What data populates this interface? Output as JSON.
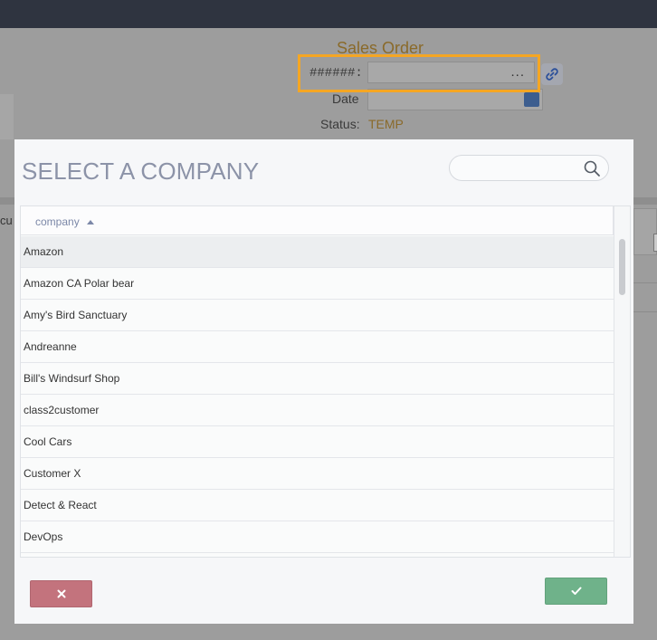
{
  "background": {
    "form_title": "Sales Order",
    "number_label": "######:",
    "number_dots": "...",
    "date_label": "Date",
    "status_label": "Status:",
    "status_value": "TEMP",
    "cut_text": "cu"
  },
  "modal": {
    "title": "SELECT A COMPANY",
    "search": {
      "value": "",
      "placeholder": ""
    },
    "grid": {
      "column_header": "company",
      "sort": "ascending",
      "rows": [
        "Amazon",
        "Amazon CA Polar bear",
        "Amy's Bird Sanctuary",
        "Andreanne",
        "Bill's Windsurf Shop",
        "class2customer",
        "Cool Cars",
        "Customer X",
        "Detect & React",
        "DevOps"
      ],
      "selected_index": 0
    },
    "buttons": {
      "cancel": "cancel",
      "confirm": "confirm"
    }
  },
  "colors": {
    "highlight": "#f5a623",
    "cancel": "#c3737d",
    "confirm": "#6fb28a",
    "title": "#8c93a8"
  }
}
